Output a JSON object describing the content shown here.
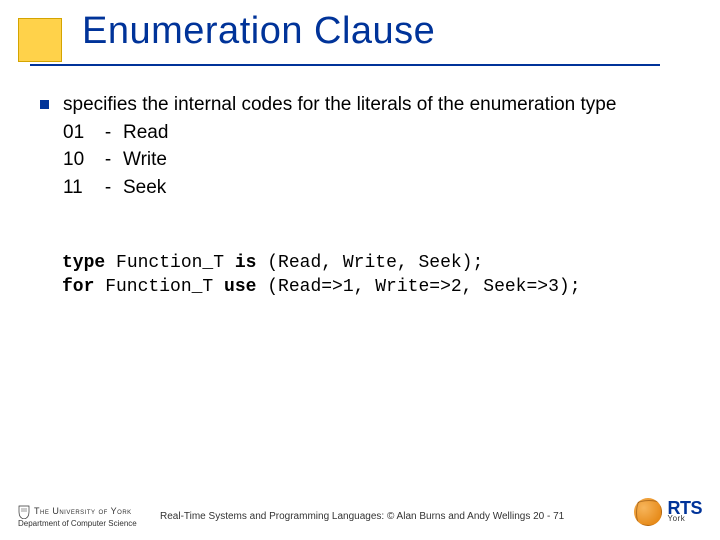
{
  "title": "Enumeration Clause",
  "bullet": {
    "lead": "specifies the internal codes for the literals of the enumeration type",
    "rows": [
      {
        "code": "01",
        "dash": "-",
        "lit": "Read"
      },
      {
        "code": "10",
        "dash": "-",
        "lit": "Write"
      },
      {
        "code": "11",
        "dash": "-",
        "lit": "Seek"
      }
    ]
  },
  "code": {
    "l1": {
      "kw1": "type",
      "t1": " Function_T ",
      "kw2": "is",
      "t2": " (Read, Write, Seek);"
    },
    "l2": {
      "kw1": "for",
      "t1": " Function_T ",
      "kw2": "use",
      "t2": " (Read=>1, Write=>2, Seek=>3);"
    }
  },
  "footer": {
    "text": "Real-Time Systems and Programming Languages: © Alan Burns and Andy Wellings 20 - 71",
    "york_title": "The University of York",
    "york_dept": "Department of Computer Science",
    "rts_main": "RTS",
    "rts_sub": "York"
  }
}
